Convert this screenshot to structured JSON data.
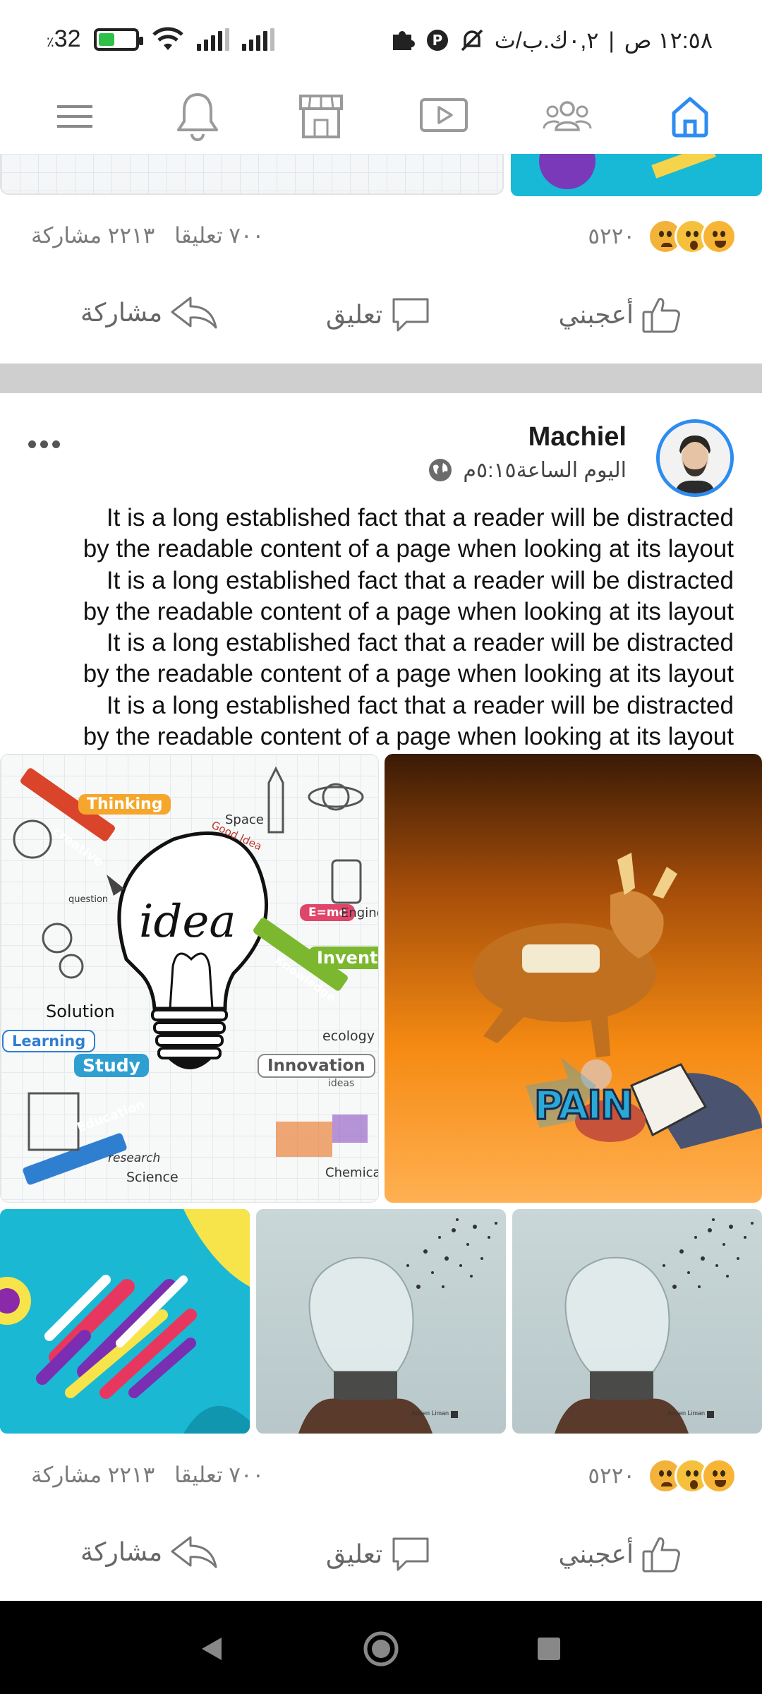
{
  "status_bar": {
    "time": "١٢:٥٨ ص",
    "network_speed": "٠,٢ك.ب/ث",
    "battery_level": "32",
    "battery_unit": "٪"
  },
  "top_nav": {
    "items": [
      {
        "name": "menu",
        "icon": "menu-icon"
      },
      {
        "name": "notifications",
        "icon": "bell-icon"
      },
      {
        "name": "marketplace",
        "icon": "store-icon"
      },
      {
        "name": "watch",
        "icon": "video-icon"
      },
      {
        "name": "groups",
        "icon": "groups-icon"
      },
      {
        "name": "home",
        "icon": "home-icon",
        "active": true
      }
    ],
    "active_color": "#2d8cf0",
    "icon_color": "#9a9a9a"
  },
  "previous_post": {
    "shares": "٢٢١٣ مشاركة",
    "comments": "٧٠٠ تعليقا",
    "reactions_count": "٥٢٢٠",
    "like_label": "أعجبني",
    "comment_label": "تعليق",
    "share_label": "مشاركة"
  },
  "post": {
    "author": "Machiel",
    "time": "اليوم الساعة٥:١٥م",
    "privacy_icon": "globe-icon",
    "text_lines": [
      "It is a long established fact that a reader will be distracted",
      "by the readable content of a page when looking at its layout",
      "It is a long established fact that a reader will be distracted",
      "by the readable content of a page when looking at its layout",
      "It is a long established fact that a reader will be distracted",
      "by the readable content of a page when looking at its layout",
      "It is a long established fact that a reader will be distracted",
      "by the readable content of a page when looking at its layout"
    ],
    "images": {
      "idea": {
        "title": "idea",
        "labels": [
          "Thinking",
          "creative",
          "Space",
          "Good Idea",
          "E=mc",
          "Engine",
          "Invent",
          "Knowledge",
          "Solution",
          "Learning",
          "Study",
          "ecology",
          "Innovation",
          "ideas",
          "Education",
          "research",
          "Science",
          "Chemica",
          "question"
        ]
      },
      "pain": {
        "label": "PAIN"
      },
      "bulb_credit": "Adrien Liman"
    },
    "shares": "٢٢١٣ مشاركة",
    "comments": "٧٠٠ تعليقا",
    "reactions_count": "٥٢٢٠",
    "like_label": "أعجبني",
    "comment_label": "تعليق",
    "share_label": "مشاركة"
  },
  "system_nav": {
    "buttons": [
      "back",
      "home",
      "recents"
    ]
  }
}
